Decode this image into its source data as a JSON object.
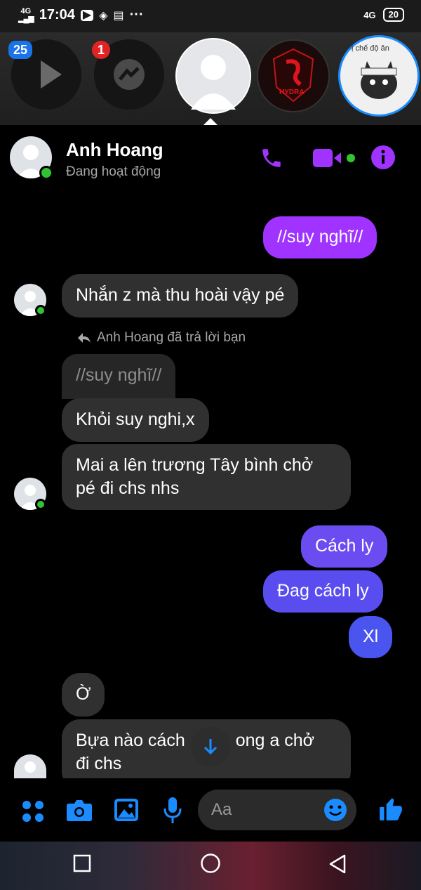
{
  "status_bar": {
    "network_top": "4G",
    "time": "17:04",
    "more": "···",
    "network_right": "4G",
    "battery": "20"
  },
  "chat_heads": {
    "badge_first": "25",
    "badge_second": "1",
    "hydra_label": "HYDRA",
    "last_label": "ị chế độ ăn"
  },
  "header": {
    "name": "Anh Hoang",
    "status": "Đang hoạt động",
    "accent": "#a033ff"
  },
  "messages": {
    "m1": "//suy nghĩ//",
    "m2": "Nhắn z mà thu hoài vậy pé",
    "reply_note": "Anh Hoang đã trả lời bạn",
    "quoted": "//suy nghĩ//",
    "m3": "Khỏi suy nghi,x",
    "m4_line1": "Mai a lên trương Tây bình chở",
    "m4_line2": "pé đi chs nhs",
    "m5": "Cách ly",
    "m6": "Đag cách ly",
    "m7": "Xl",
    "m8": "Ờ",
    "m9_line1": "Bựa nào cách",
    "m9_line1_end": "ong a chở",
    "m9_line2": "đi chs"
  },
  "composer": {
    "placeholder": "Aa"
  },
  "colors": {
    "out_purple": "#a033ff",
    "out_indigo": "#5a4df0",
    "in_bg": "#303030",
    "icon_blue": "#1a8cff"
  }
}
